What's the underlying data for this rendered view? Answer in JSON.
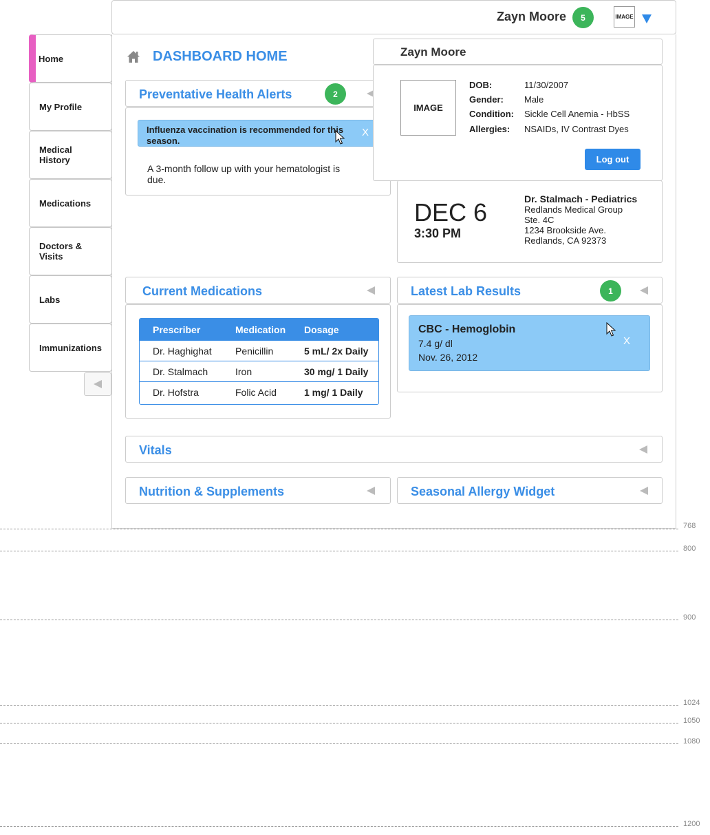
{
  "header": {
    "user_name": "Zayn Moore",
    "notification_count": "5",
    "avatar_label": "IMAGE"
  },
  "sidebar": {
    "items": [
      {
        "label": "Home",
        "active": true
      },
      {
        "label": "My Profile",
        "active": false
      },
      {
        "label": "Medical History",
        "active": false
      },
      {
        "label": "Medications",
        "active": false
      },
      {
        "label": "Doctors & Visits",
        "active": false
      },
      {
        "label": "Labs",
        "active": false
      },
      {
        "label": "Immunizations",
        "active": false
      }
    ]
  },
  "page": {
    "title": "DASHBOARD HOME"
  },
  "alerts_widget": {
    "title": "Preventative Health Alerts",
    "badge": "2",
    "alert_primary": "Influenza vaccination is recommended for this season.",
    "close_label": "X",
    "alert_secondary": "A 3-month follow up with your hematologist is due."
  },
  "appointment": {
    "date": "DEC 6",
    "time": "3:30 PM",
    "doctor": "Dr. Stalmach - Pediatrics",
    "practice": "Redlands Medical Group",
    "suite": "Ste. 4C",
    "street": "1234 Brookside Ave.",
    "city": "Redlands, CA 92373"
  },
  "profile_dropdown": {
    "name": "Zayn Moore",
    "image_label": "IMAGE",
    "dob_label": "DOB:",
    "dob": "11/30/2007",
    "gender_label": "Gender:",
    "gender": "Male",
    "condition_label": "Condition:",
    "condition": "Sickle Cell Anemia - HbSS",
    "allergies_label": "Allergies:",
    "allergies": "NSAIDs, IV Contrast Dyes",
    "logout_label": "Log out"
  },
  "medications_widget": {
    "title": "Current Medications",
    "columns": [
      "Prescriber",
      "Medication",
      "Dosage"
    ],
    "rows": [
      [
        "Dr. Haghighat",
        "Penicillin",
        "5 mL/ 2x Daily"
      ],
      [
        "Dr. Stalmach",
        "Iron",
        "30 mg/ 1 Daily"
      ],
      [
        "Dr. Hofstra",
        "Folic Acid",
        "1 mg/ 1 Daily"
      ]
    ]
  },
  "labs_widget": {
    "title": "Latest Lab Results",
    "badge": "1",
    "test": "CBC - Hemoglobin",
    "value": "7.4 g/ dl",
    "date": "Nov. 26, 2012",
    "close_label": "X"
  },
  "vitals_widget": {
    "title": "Vitals"
  },
  "nutrition_widget": {
    "title": "Nutrition & Supplements"
  },
  "allergy_widget": {
    "title": "Seasonal Allergy Widget"
  },
  "guides": [
    "768",
    "800",
    "900",
    "1024",
    "1050",
    "1080",
    "1200"
  ],
  "colors": {
    "accent": "#3a8ee6",
    "alert_bg": "#8ccaf7",
    "badge": "#3cb55a",
    "active_nav": "#e75fc2"
  }
}
